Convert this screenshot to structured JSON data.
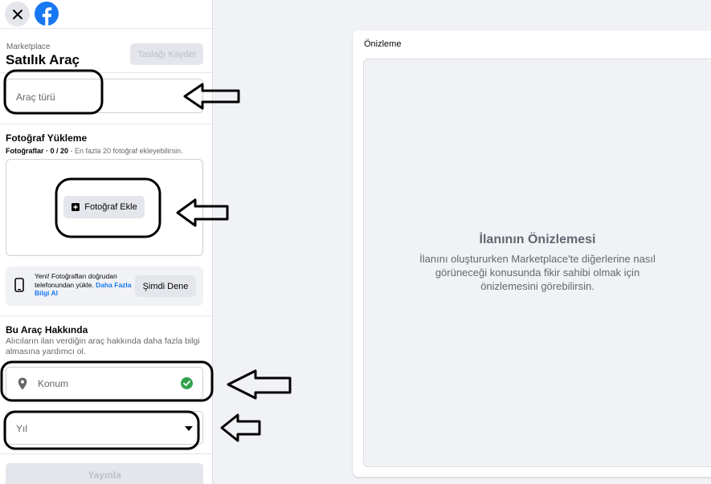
{
  "header": {
    "close_label": "×"
  },
  "form": {
    "breadcrumb": "Marketplace",
    "title": "Satılık Araç",
    "save_draft": "Taslağı Kaydet",
    "vehicle_type_placeholder": "Araç türü",
    "photos": {
      "title": "Fotoğraf Yükleme",
      "sub_prefix": "Fotoğraflar · 0 / 20",
      "sub_suffix": " - En fazla 20 fotoğraf ekleyebilirsin.",
      "add_button": "Fotoğraf Ekle"
    },
    "phone_upload": {
      "text": "Yeni! Fotoğrafları doğrudan telefonundan yükle.",
      "link": "Daha Fazla Bilgi Al",
      "button": "Şimdi Dene"
    },
    "about": {
      "title": "Bu Araç Hakkında",
      "description": "Alıcıların ilan verdiğin araç hakkında daha fazla bilgi almasına yardımcı ol."
    },
    "location_placeholder": "Konum",
    "year_placeholder": "Yıl",
    "publish": "Yayınla"
  },
  "preview": {
    "label": "Önizleme",
    "heading": "İlanının Önizlemesi",
    "description": "İlanını oluştururken Marketplace'te diğerlerine nasıl görüneceği konusunda fikir sahibi olmak için önizlemesini görebilirsin."
  },
  "colors": {
    "brand": "#1877f2",
    "success": "#31a24c",
    "secondary_button": "#e4e6eb"
  }
}
